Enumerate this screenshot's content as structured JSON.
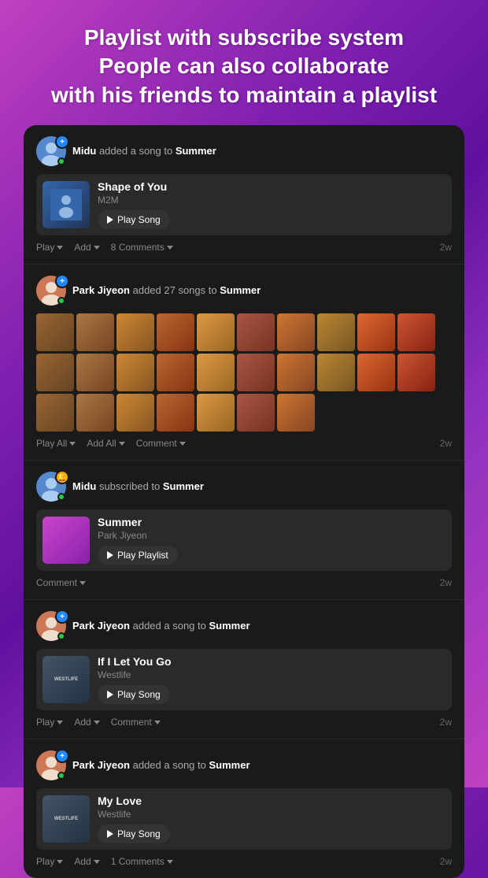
{
  "header": {
    "line1": "Playlist with subscribe system",
    "line2": "People can also collaborate",
    "line3": "with his friends to maintain a playlist"
  },
  "feed": [
    {
      "id": "feed1",
      "avatar_label": "Midu",
      "avatar_class": "av-midu",
      "badge_type": "add",
      "action_text": " added a song to ",
      "target": "Summer",
      "song": {
        "title": "Shape of You",
        "artist": "M2M",
        "play_label": "Play Song"
      },
      "actions": [
        {
          "label": "Play",
          "has_chevron": true
        },
        {
          "label": "Add",
          "has_chevron": true
        },
        {
          "label": "8 Comments",
          "has_chevron": true
        }
      ],
      "timestamp": "2w"
    },
    {
      "id": "feed2",
      "avatar_label": "Park Jiyeon",
      "avatar_class": "av-park",
      "badge_type": "add",
      "action_text": " added 27 songs to ",
      "target": "Summer",
      "grid_count": 27,
      "actions": [
        {
          "label": "Play All",
          "has_chevron": true
        },
        {
          "label": "Add All",
          "has_chevron": true
        },
        {
          "label": "Comment",
          "has_chevron": true
        }
      ],
      "timestamp": "2w"
    },
    {
      "id": "feed3",
      "avatar_label": "Midu",
      "avatar_class": "av-midu",
      "badge_type": "notif",
      "action_text": " subscribed to ",
      "target": "Summer",
      "playlist": {
        "name": "Summer",
        "owner": "Park Jiyeon",
        "play_label": "Play Playlist"
      },
      "actions": [
        {
          "label": "Comment",
          "has_chevron": true
        }
      ],
      "timestamp": "2w"
    },
    {
      "id": "feed4",
      "avatar_label": "Park Jiyeon",
      "avatar_class": "av-park2",
      "badge_type": "add",
      "action_text": " added a song to ",
      "target": "Summer",
      "song": {
        "title": "If I Let You Go",
        "artist": "Westlife",
        "play_label": "Play Song",
        "is_westlife": true
      },
      "actions": [
        {
          "label": "Play",
          "has_chevron": true
        },
        {
          "label": "Add",
          "has_chevron": true
        },
        {
          "label": "Comment",
          "has_chevron": true
        }
      ],
      "timestamp": "2w"
    },
    {
      "id": "feed5",
      "avatar_label": "Park Jiyeon",
      "avatar_class": "av-park2",
      "badge_type": "add",
      "action_text": " added a song to ",
      "target": "Summer",
      "song": {
        "title": "My Love",
        "artist": "Westlife",
        "play_label": "Play Song",
        "is_westlife": true
      },
      "actions": [
        {
          "label": "Play",
          "has_chevron": true
        },
        {
          "label": "Add",
          "has_chevron": true
        },
        {
          "label": "1 Comments",
          "has_chevron": true
        }
      ],
      "timestamp": "2w"
    }
  ],
  "grid_colors": [
    "c1",
    "c2",
    "c3",
    "c4",
    "c5",
    "c6",
    "c7",
    "c8",
    "c9",
    "c10",
    "c1",
    "c2",
    "c3",
    "c4",
    "c5",
    "c6",
    "c7",
    "c8",
    "c9",
    "c10",
    "c1",
    "c2",
    "c3",
    "c4",
    "c5",
    "c6",
    "c7"
  ]
}
